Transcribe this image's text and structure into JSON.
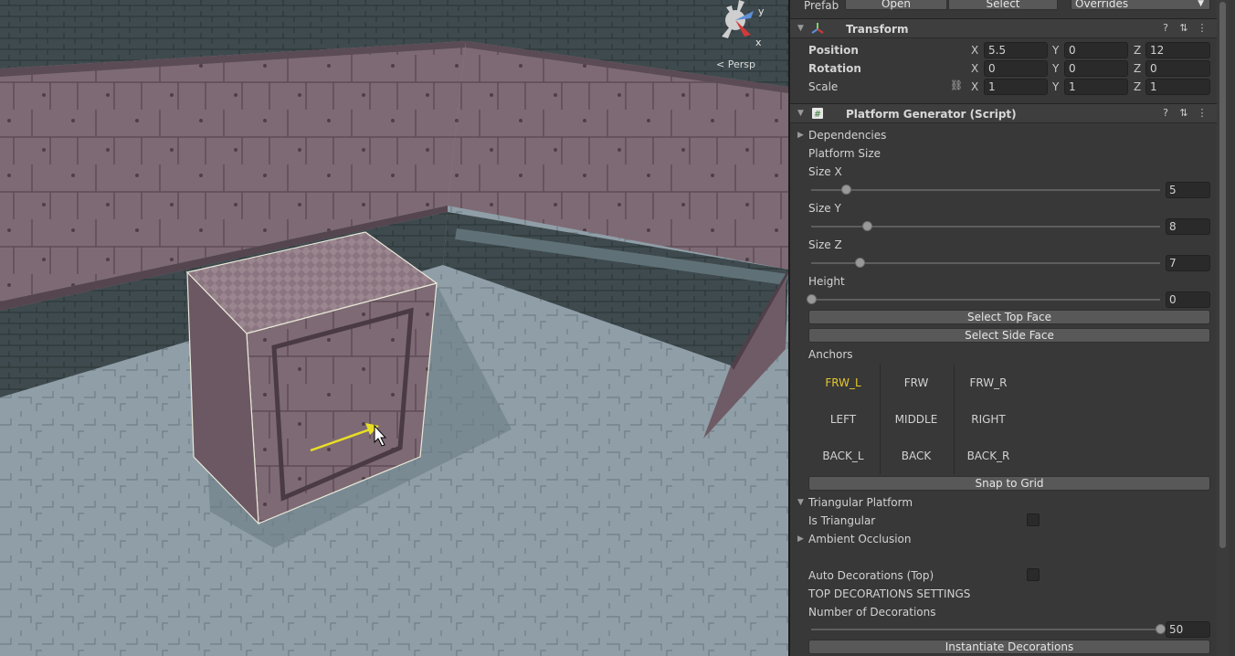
{
  "scene": {
    "persp_label": "< Persp",
    "gizmo_axes": {
      "y": "y",
      "x": "x"
    }
  },
  "prefab_bar": {
    "label": "Prefab",
    "open_label": "Open",
    "select_label": "Select",
    "overrides_label": "Overrides"
  },
  "transform": {
    "title": "Transform",
    "position": {
      "label": "Position",
      "x": "5.5",
      "y": "0",
      "z": "12"
    },
    "rotation": {
      "label": "Rotation",
      "x": "0",
      "y": "0",
      "z": "0"
    },
    "scale": {
      "label": "Scale",
      "x": "1",
      "y": "1",
      "z": "1"
    },
    "axis_labels": {
      "x": "X",
      "y": "Y",
      "z": "Z"
    }
  },
  "platform_generator": {
    "title": "Platform Generator (Script)",
    "dependencies_label": "Dependencies",
    "platform_size_label": "Platform Size",
    "sliders": [
      {
        "label": "Size X",
        "value": "5",
        "fraction": 0.1
      },
      {
        "label": "Size Y",
        "value": "8",
        "fraction": 0.16
      },
      {
        "label": "Size Z",
        "value": "7",
        "fraction": 0.14
      },
      {
        "label": "Height",
        "value": "0",
        "fraction": 0.0
      }
    ],
    "select_top_face": "Select Top Face",
    "select_side_face": "Select Side Face",
    "anchors_label": "Anchors",
    "anchors": [
      [
        "FRW_L",
        "FRW",
        "FRW_R"
      ],
      [
        "LEFT",
        "MIDDLE",
        "RIGHT"
      ],
      [
        "BACK_L",
        "BACK",
        "BACK_R"
      ]
    ],
    "selected_anchor": "FRW_L",
    "snap_to_grid": "Snap to Grid",
    "triangular_platform_label": "Triangular Platform",
    "is_triangular_label": "Is Triangular",
    "ambient_occlusion_label": "Ambient Occlusion",
    "auto_decorations_label": "Auto Decorations (Top)",
    "top_decorations_settings_label": "TOP DECORATIONS SETTINGS",
    "number_of_decorations": {
      "label": "Number of Decorations",
      "value": "50",
      "fraction": 1.0
    },
    "instantiate_decorations": "Instantiate Decorations"
  },
  "colors": {
    "selected_anchor": "#e6c72c",
    "inspector_bg": "#383838",
    "floor": "#8d9da6",
    "wall_panel": "#7a6670"
  }
}
